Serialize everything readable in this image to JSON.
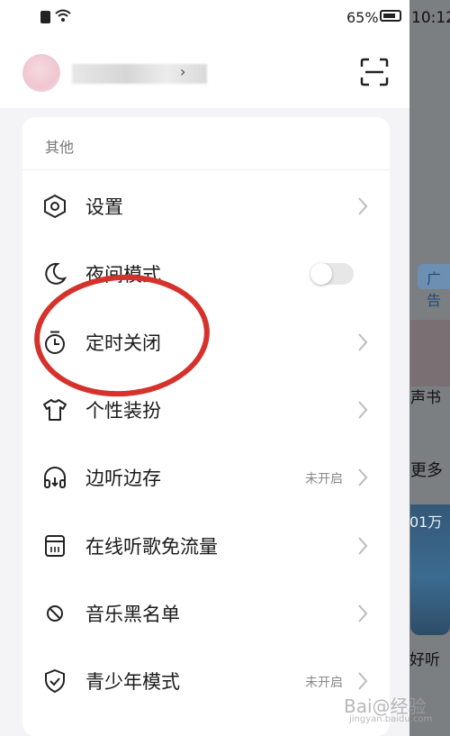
{
  "status_bar": {
    "battery": "65%",
    "time": "10:12"
  },
  "profile": {
    "arrow": "›"
  },
  "section": {
    "title": "其他"
  },
  "menu": {
    "items": [
      {
        "label": "设置",
        "status": "",
        "icon": "hexagon-settings-icon"
      },
      {
        "label": "夜间模式",
        "status": "",
        "icon": "moon-icon",
        "toggle": false
      },
      {
        "label": "定时关闭",
        "status": "",
        "icon": "timer-icon"
      },
      {
        "label": "个性装扮",
        "status": "",
        "icon": "shirt-icon"
      },
      {
        "label": "边听边存",
        "status": "未开启",
        "icon": "headphones-icon"
      },
      {
        "label": "在线听歌免流量",
        "status": "",
        "icon": "sim-card-icon"
      },
      {
        "label": "音乐黑名单",
        "status": "",
        "icon": "block-icon"
      },
      {
        "label": "青少年模式",
        "status": "未开启",
        "icon": "shield-check-icon"
      }
    ]
  },
  "background_app": {
    "ad_label": "广告",
    "book_label": "声书",
    "more_label": "更多",
    "play_count": "01万",
    "song_label": "好听"
  },
  "watermark": {
    "text": "Bai@经验",
    "sub": "jingyan.baidu.com"
  },
  "colors": {
    "highlight": "#d6322c",
    "toggle_off": "#e7e7e7"
  }
}
